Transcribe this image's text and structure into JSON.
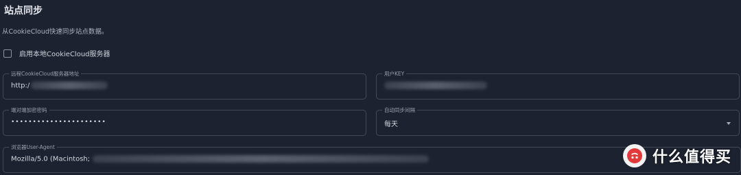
{
  "section": {
    "title": "站点同步",
    "description": "从CookieCloud快速同步站点数据。"
  },
  "enable_local": {
    "label": "启用本地CookieCloud服务器",
    "checked": false
  },
  "fields": {
    "server_url": {
      "label": "远程CookieCloud服务器地址",
      "value": "http:/"
    },
    "user_key": {
      "label": "用户KEY",
      "value": ""
    },
    "password": {
      "label": "端对端加密密码",
      "value": "••••••••••••••••••••••"
    },
    "sync_interval": {
      "label": "自动同步间隔",
      "value": "每天"
    },
    "user_agent": {
      "label": "浏览器User-Agent",
      "value": "Mozilla/5.0 (Macintosh;"
    }
  },
  "watermark": {
    "text": "什么值得买",
    "icon": "smzdm-logo-icon"
  },
  "colors": {
    "background": "#1d2230",
    "field_border": "#434a59"
  }
}
